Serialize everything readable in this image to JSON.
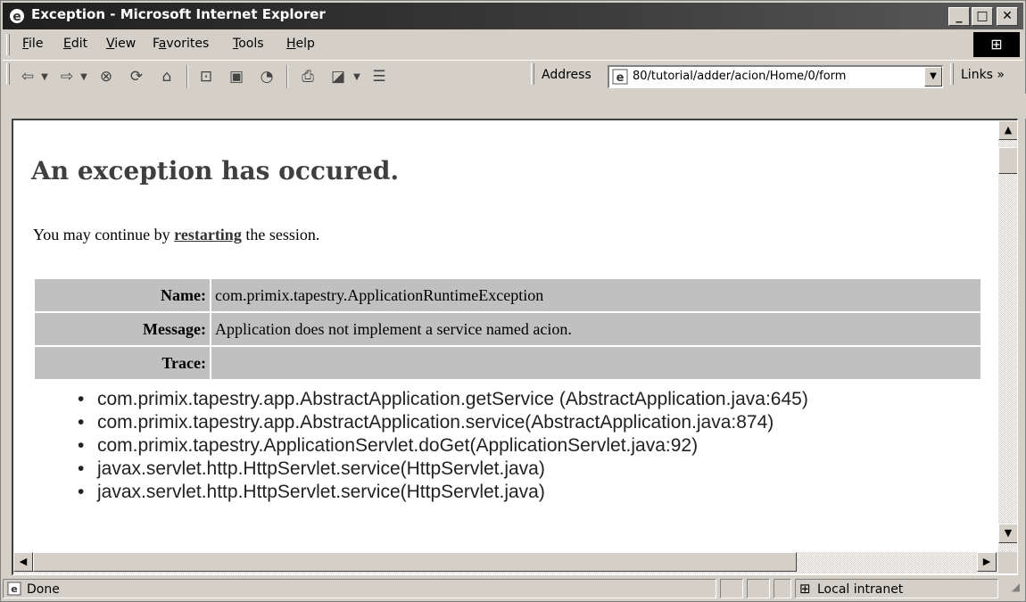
{
  "window": {
    "title": "Exception - Microsoft Internet Explorer",
    "minimize": "_",
    "maximize": "□",
    "close": "✕"
  },
  "menu": [
    {
      "label": "File",
      "key": "F",
      "rest": "ile"
    },
    {
      "label": "Edit",
      "key": "E",
      "rest": "dit"
    },
    {
      "label": "View",
      "key": "V",
      "rest": "iew"
    },
    {
      "label": "Favorites",
      "key": "a",
      "pre": "F",
      "rest": "vorites"
    },
    {
      "label": "Tools",
      "key": "T",
      "rest": "ools"
    },
    {
      "label": "Help",
      "key": "H",
      "rest": "elp"
    }
  ],
  "toolbar": {
    "address_label": "Address",
    "address_value": "80/tutorial/adder/acion/Home/0/form",
    "links_label": "Links »"
  },
  "page": {
    "heading": "An exception has occured.",
    "para_before": "You may continue by ",
    "link_text": "restarting",
    "para_after": " the session.",
    "rows": [
      {
        "label": "Name:",
        "value": "com.primix.tapestry.ApplicationRuntimeException"
      },
      {
        "label": "Message:",
        "value": "Application does not implement a service named acion."
      },
      {
        "label": "Trace:",
        "value": ""
      }
    ],
    "trace": [
      "com.primix.tapestry.app.AbstractApplication.getService (AbstractApplication.java:645)",
      "com.primix.tapestry.app.AbstractApplication.service(AbstractApplication.java:874)",
      "com.primix.tapestry.ApplicationServlet.doGet(ApplicationServlet.java:92)",
      "javax.servlet.http.HttpServlet.service(HttpServlet.java)",
      "javax.servlet.http.HttpServlet.service(HttpServlet.java)"
    ]
  },
  "status": {
    "text": "Done",
    "zone": "Local intranet"
  },
  "icons": {
    "back": "back-arrow-icon",
    "forward": "forward-arrow-icon",
    "stop": "stop-icon",
    "refresh": "refresh-icon",
    "home": "home-icon",
    "search": "search-icon",
    "favorites": "favorites-icon",
    "history": "history-icon",
    "print": "print-icon",
    "edit": "edit-icon",
    "discuss": "discuss-icon"
  }
}
